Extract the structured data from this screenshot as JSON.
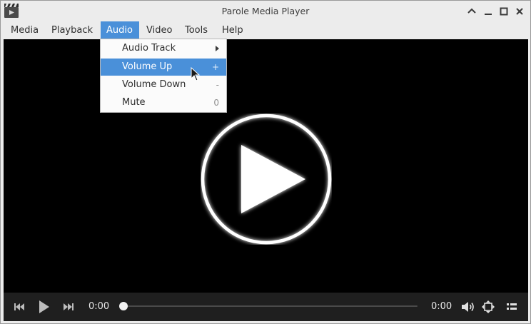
{
  "window": {
    "title": "Parole Media Player"
  },
  "menubar": [
    "Media",
    "Playback",
    "Audio",
    "Video",
    "Tools",
    "Help"
  ],
  "audio_menu": {
    "items": [
      {
        "label": "Audio Track",
        "accel": "",
        "submenu": true
      },
      {
        "label": "Volume Up",
        "accel": "+",
        "highlighted": true
      },
      {
        "label": "Volume Down",
        "accel": "-"
      },
      {
        "label": "Mute",
        "accel": "0"
      }
    ]
  },
  "controls": {
    "current_time": "0:00",
    "total_time": "0:00",
    "seek_progress": 0
  },
  "icons": {
    "app": "clapperboard-icon",
    "titlebar": [
      "maximize-up-icon",
      "minimize-icon",
      "restore-icon",
      "close-icon"
    ],
    "controls": [
      "previous-icon",
      "play-icon",
      "next-icon",
      "volume-icon",
      "fullscreen-icon",
      "playlist-icon"
    ]
  },
  "colors": {
    "accent": "#4a90d9",
    "video_bg": "#000000",
    "controls_bg": "#1f1f1f"
  }
}
